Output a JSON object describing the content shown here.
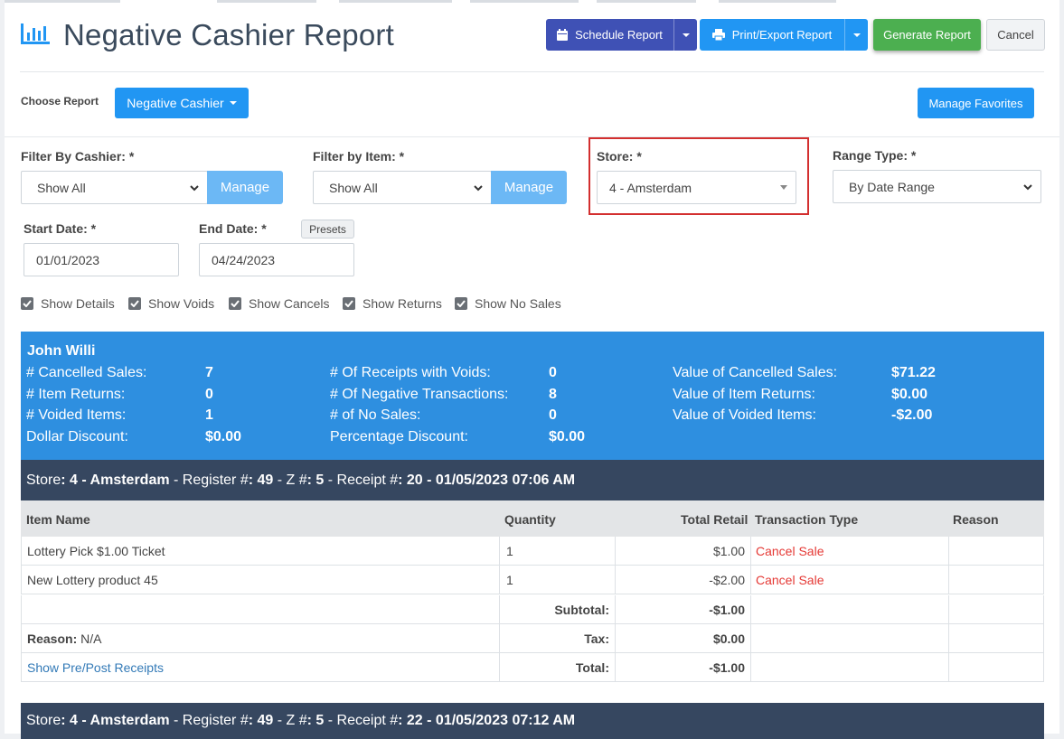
{
  "header": {
    "title": "Negative Cashier Report",
    "schedule_label": "Schedule Report",
    "print_label": "Print/Export Report",
    "generate_label": "Generate Report",
    "cancel_label": "Cancel"
  },
  "report_select": {
    "label": "Choose Report",
    "value": "Negative Cashier",
    "favorites_label": "Manage Favorites"
  },
  "filters": {
    "cashier_label": "Filter By Cashier: *",
    "cashier_value": "Show All",
    "item_label": "Filter by Item: *",
    "item_value": "Show All",
    "manage_label": "Manage",
    "store_label": "Store: *",
    "store_value": "4 - Amsterdam",
    "range_label": "Range Type: *",
    "range_value": "By Date Range",
    "start_label": "Start Date: *",
    "start_value": "01/01/2023",
    "end_label": "End Date: *",
    "end_value": "04/24/2023",
    "presets_label": "Presets"
  },
  "options": [
    {
      "label": "Show Details",
      "checked": true
    },
    {
      "label": "Show Voids",
      "checked": true
    },
    {
      "label": "Show Cancels",
      "checked": true
    },
    {
      "label": "Show Returns",
      "checked": true
    },
    {
      "label": "Show No Sales",
      "checked": true
    }
  ],
  "summary": {
    "cashier": "John Willi",
    "cancelled_sales_label": "# Cancelled Sales:",
    "cancelled_sales": "7",
    "item_returns_label": "# Item Returns:",
    "item_returns": "0",
    "voided_items_label": "# Voided Items:",
    "voided_items": "1",
    "dollar_discount_label": "Dollar Discount:",
    "dollar_discount": "$0.00",
    "receipts_voids_label": "# Of Receipts with Voids:",
    "receipts_voids": "0",
    "negative_tx_label": "# Of Negative Transactions:",
    "negative_tx": "8",
    "no_sales_label": "# of No Sales:",
    "no_sales": "0",
    "pct_discount_label": "Percentage Discount:",
    "pct_discount": "$0.00",
    "value_cancelled_label": "Value of Cancelled Sales:",
    "value_cancelled": "$71.22",
    "value_returns_label": "Value of Item Returns:",
    "value_returns": "$0.00",
    "value_voided_label": "Value of Voided Items:",
    "value_voided": "-$2.00"
  },
  "receipt1": {
    "store_prefix": "Store",
    "store": ": 4 - Amsterdam",
    "register_prefix": " - Register #",
    "register": ": 49",
    "z_prefix": " - Z #",
    "z": ": 5",
    "receipt_prefix": " - Receipt #",
    "receipt": ": 20 - 01/05/2023 07:06 AM"
  },
  "receipt2": {
    "store_prefix": "Store",
    "store": ": 4 - Amsterdam",
    "register_prefix": " - Register #",
    "register": ": 49",
    "z_prefix": " - Z #",
    "z": ": 5",
    "receipt_prefix": " - Receipt #",
    "receipt": ": 22 - 01/05/2023 07:12 AM"
  },
  "table": {
    "col_item": "Item Name",
    "col_qty": "Quantity",
    "col_retail": "Total Retail",
    "col_type": "Transaction Type",
    "col_reason": "Reason",
    "rows": [
      {
        "item": "Lottery Pick $1.00 Ticket",
        "qty": "1",
        "retail": "$1.00",
        "type": "Cancel Sale"
      },
      {
        "item": "New Lottery product 45",
        "qty": "1",
        "retail": "-$2.00",
        "type": "Cancel Sale"
      }
    ],
    "subtotal_label": "Subtotal:",
    "subtotal": "-$1.00",
    "reason_label": "Reason:",
    "reason": " N/A",
    "tax_label": "Tax:",
    "tax": "$0.00",
    "prepost_link": "Show Pre/Post Receipts",
    "total_label": "Total:",
    "total": "-$1.00"
  }
}
